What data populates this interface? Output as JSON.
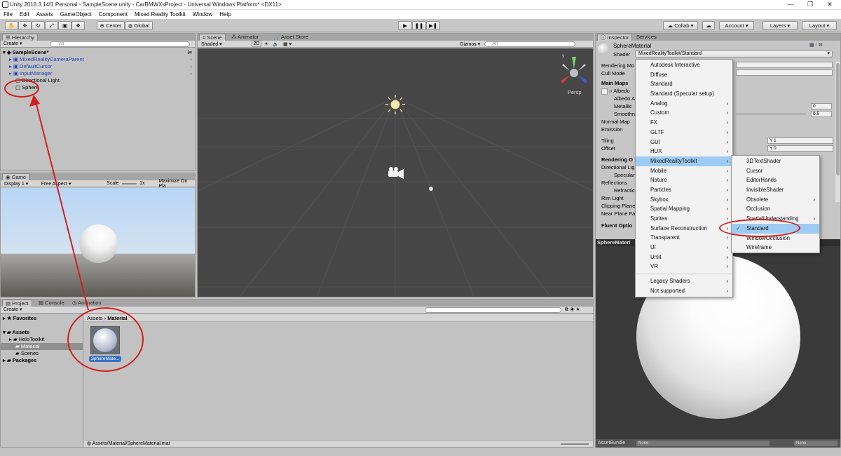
{
  "window": {
    "title": "Unity 2018.3.14f1 Personal - SampleScene.unity - CarBMWXsProject - Universal Windows Platform* <DX11>",
    "minimize": "—",
    "maximize": "❐",
    "close": "✕"
  },
  "menu": [
    "File",
    "Edit",
    "Assets",
    "GameObject",
    "Component",
    "Mixed Reality Toolkit",
    "Window",
    "Help"
  ],
  "toolbar": {
    "center": "Center",
    "global": "Global",
    "collab": "Collab",
    "account": "Account",
    "layers": "Layers",
    "layout": "Layout"
  },
  "hierarchy": {
    "tab": "Hierarchy",
    "create": "Create",
    "search_placeholder": "All",
    "scene": "SampleScene*",
    "items": [
      "MixedRealityCameraParent",
      "DefaultCursor",
      "InputManager",
      "Directional Light",
      "Sphere"
    ]
  },
  "scene_view": {
    "tabs": [
      "Scene",
      "Animator",
      "Asset Store"
    ],
    "shaded": "Shaded",
    "mode_2d": "2D",
    "gizmos": "Gizmos",
    "search_placeholder": "All",
    "persp": "Persp"
  },
  "game_view": {
    "tab": "Game",
    "display": "Display 1",
    "aspect": "Free Aspect",
    "scale_label": "Scale",
    "scale_value": "1x",
    "maximize": "Maximize On Pla"
  },
  "project": {
    "tabs": [
      "Project",
      "Console",
      "Animation"
    ],
    "create": "Create",
    "tree": [
      "Favorites",
      "Assets",
      "HoloToolkit",
      "Material",
      "Scenes",
      "Packages"
    ],
    "breadcrumb": [
      "Assets",
      "Material"
    ],
    "asset_name": "SphereMate...",
    "status_path": "Assets/Material/SphereMaterial.mat"
  },
  "inspector": {
    "tabs": [
      "Inspector",
      "Services"
    ],
    "material_name": "SphereMaterial",
    "shader_label": "Shader",
    "shader_value": "MixedRealityToolkit/Standard",
    "rows": [
      "Rendering Mo",
      "Cull Mode",
      "Main Maps",
      "Albedo",
      "Albedo A",
      "Metallic",
      "Smoothn",
      "Normal Map",
      "Emission",
      "Tiling",
      "Offset",
      "Rendering O",
      "Directional Lig",
      "Specular",
      "Reflections",
      "Refractic",
      "Rim Light",
      "Clipping Plane",
      "Near Plane Fa",
      "Fluent Optio"
    ],
    "metallic_value": "0",
    "smooth_value": "0.5",
    "tiling_x": "X",
    "tiling_y": "1",
    "offset_y": "0",
    "preview_title": "SphereMateri",
    "assetbundle_label": "AssetBundle",
    "none1": "None",
    "none2": "None"
  },
  "shader_menu": {
    "items": [
      "Autodesk Interactive",
      "Diffuse",
      "Standard",
      "Standard (Specular setup)",
      "Analog",
      "Custom",
      "FX",
      "GLTF",
      "GUI",
      "HUX",
      "MixedRealityToolkit",
      "Mobile",
      "Nature",
      "Particles",
      "Skybox",
      "Spatial Mapping",
      "Sprites",
      "Surface Reconstruction",
      "Transparent",
      "UI",
      "Unlit",
      "VR"
    ],
    "has_submenu": [
      false,
      false,
      false,
      false,
      true,
      true,
      true,
      true,
      true,
      true,
      true,
      true,
      true,
      true,
      true,
      true,
      true,
      true,
      true,
      true,
      true,
      true
    ],
    "extra": [
      "Legacy Shaders",
      "Not supported"
    ],
    "highlighted": "MixedRealityToolkit"
  },
  "submenu": {
    "items": [
      "3DTextShader",
      "Cursor",
      "EditorHands",
      "InvisibleShader",
      "Obsolete",
      "Occlusion",
      "SpatialUnderstanding",
      "Standard",
      "WindowOcclusion",
      "Wireframe"
    ],
    "has_submenu": [
      false,
      false,
      false,
      false,
      true,
      false,
      true,
      false,
      false,
      false
    ],
    "checked": "Standard",
    "check_mark": "✓"
  },
  "colors": {
    "annotation": "#d41e1e",
    "highlight": "#9ecbf4",
    "scene_bg": "#474747"
  }
}
